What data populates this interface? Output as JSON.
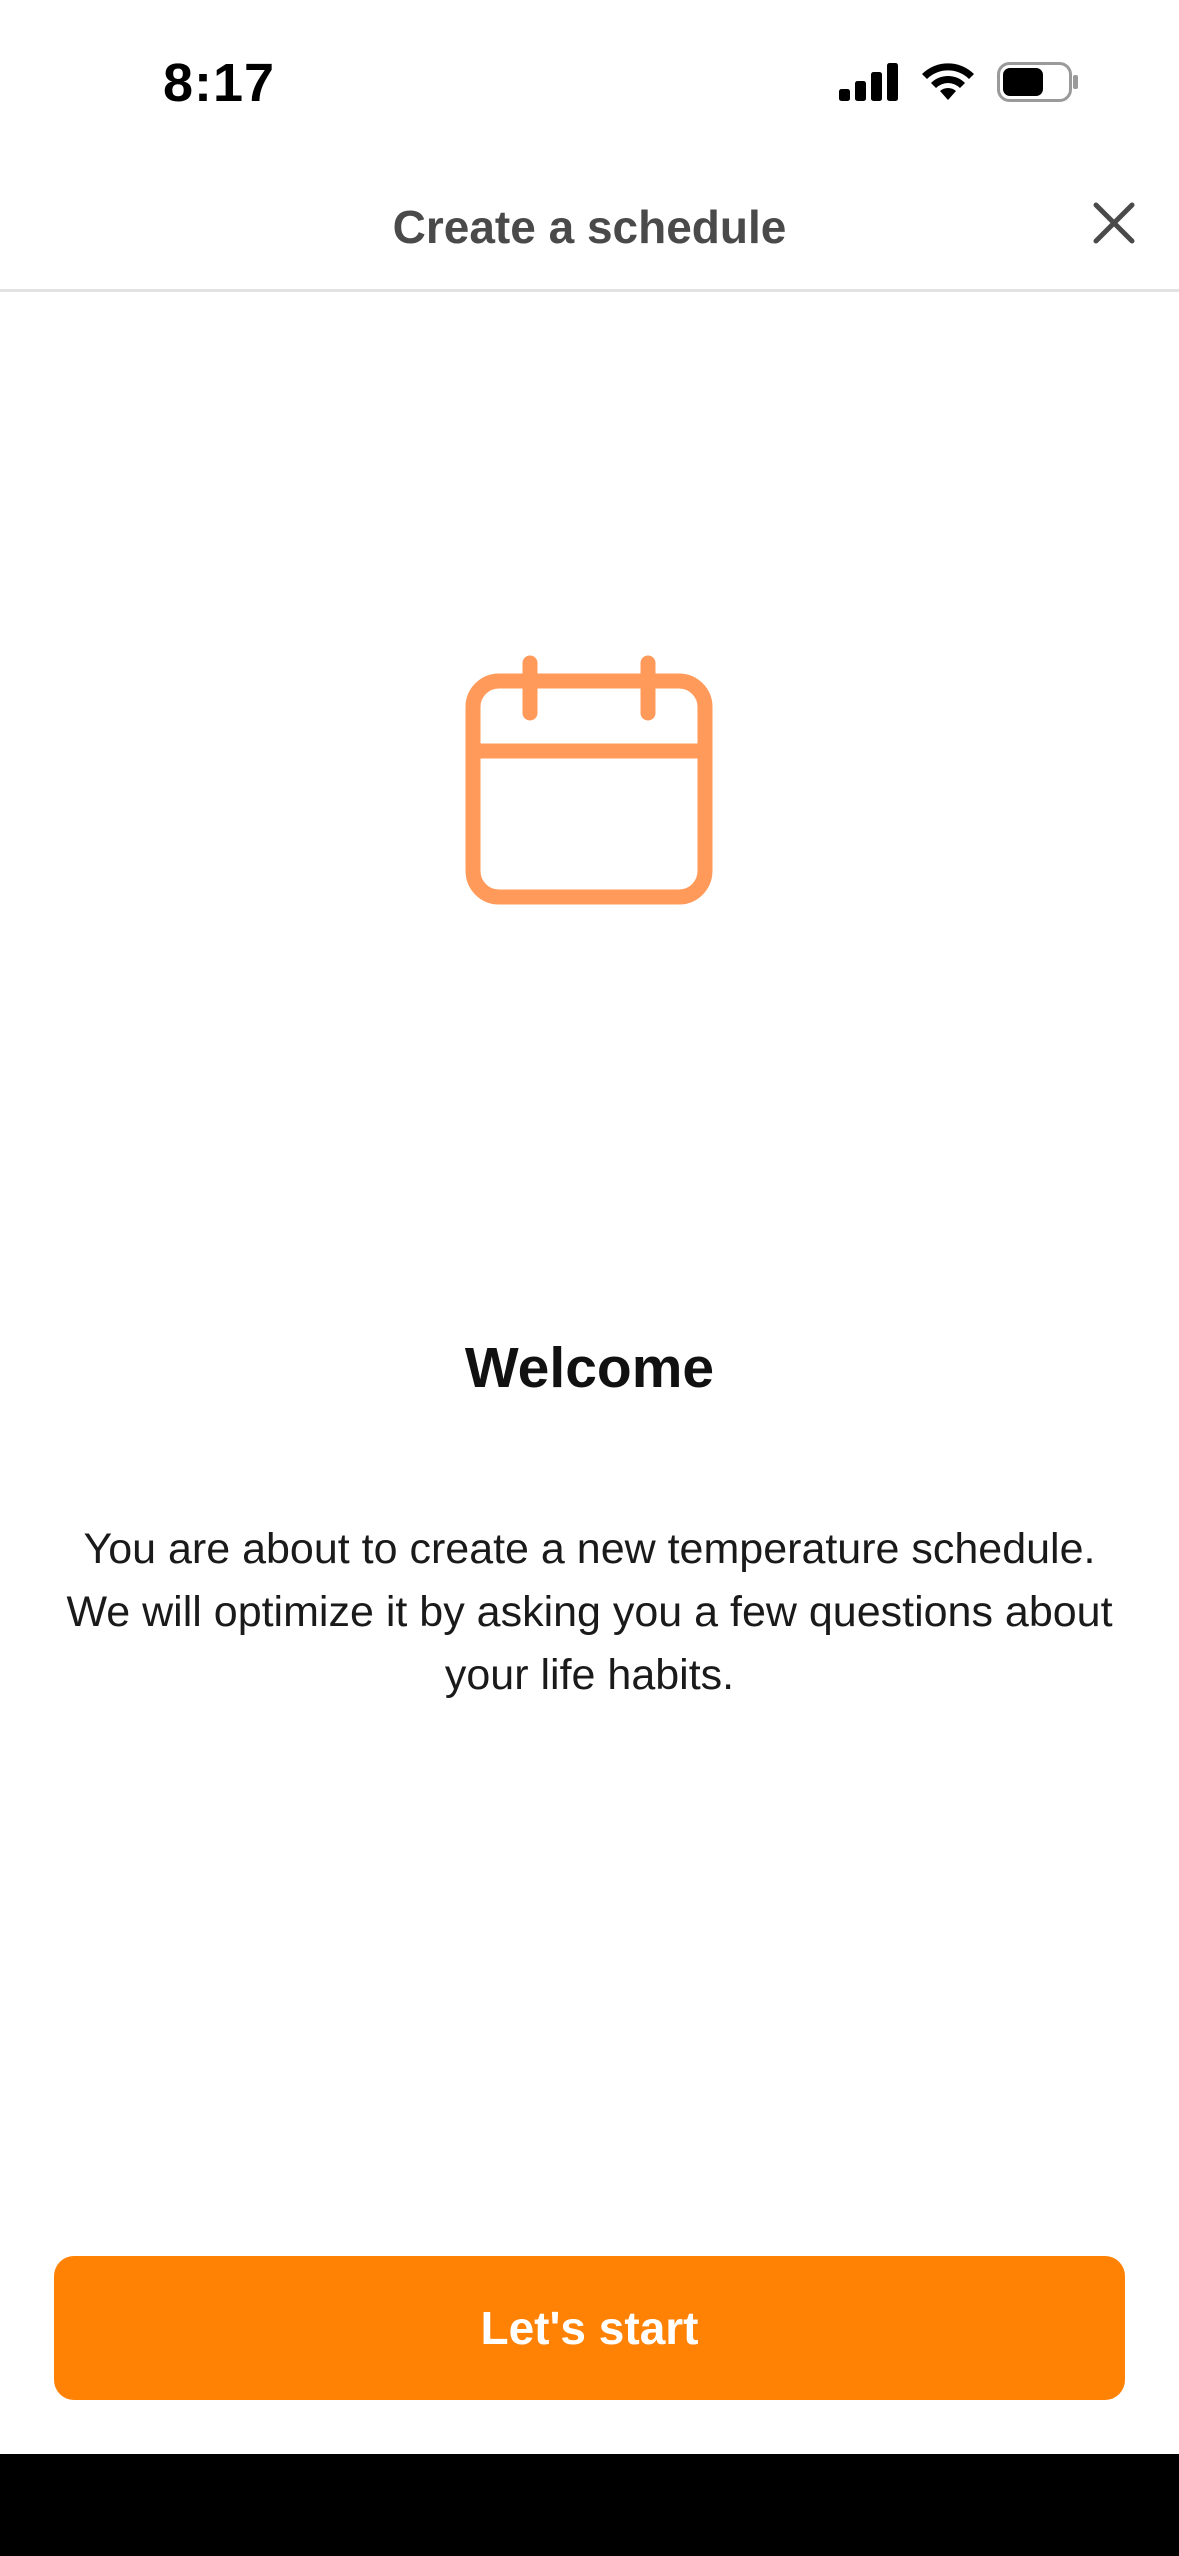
{
  "status_bar": {
    "time": "8:17",
    "icons": [
      "cellular-signal-icon",
      "wifi-icon",
      "battery-icon"
    ]
  },
  "header": {
    "title": "Create a schedule",
    "close_icon": "close-icon"
  },
  "hero": {
    "icon": "calendar-icon",
    "icon_color": "#ff9a5a"
  },
  "content": {
    "title": "Welcome",
    "body": "You are about to create a new temperature schedule. We will optimize it by asking you a few questions about your life habits."
  },
  "actions": {
    "start_label": "Let's start",
    "accent_color": "#ff8205"
  }
}
